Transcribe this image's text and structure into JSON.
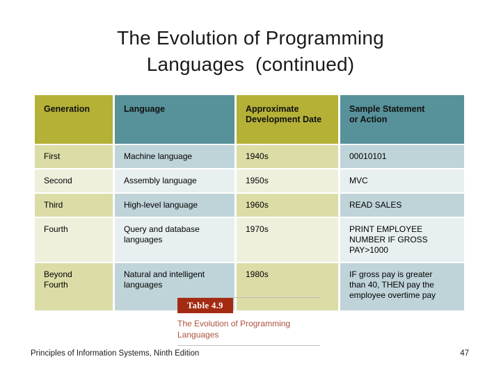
{
  "slide": {
    "title_line1": "The Evolution of Programming",
    "title_line2": "Languages  (continued)"
  },
  "table": {
    "headers": [
      {
        "line1": "Generation",
        "line2": ""
      },
      {
        "line1": "Language",
        "line2": ""
      },
      {
        "line1": "Approximate",
        "line2": "Development Date"
      },
      {
        "line1": "Sample Statement",
        "line2": "or Action"
      }
    ],
    "rows": [
      {
        "generation_l1": "First",
        "generation_l2": "",
        "language_l1": "Machine language",
        "language_l2": "",
        "date": "1940s",
        "sample_l1": "00010101",
        "sample_l2": "",
        "sample_l3": ""
      },
      {
        "generation_l1": "Second",
        "generation_l2": "",
        "language_l1": "Assembly language",
        "language_l2": "",
        "date": "1950s",
        "sample_l1": "MVC",
        "sample_l2": "",
        "sample_l3": ""
      },
      {
        "generation_l1": "Third",
        "generation_l2": "",
        "language_l1": "High-level language",
        "language_l2": "",
        "date": "1960s",
        "sample_l1": "READ SALES",
        "sample_l2": "",
        "sample_l3": ""
      },
      {
        "generation_l1": "Fourth",
        "generation_l2": "",
        "language_l1": "Query and database",
        "language_l2": "languages",
        "date": "1970s",
        "sample_l1": "PRINT EMPLOYEE",
        "sample_l2": "NUMBER IF GROSS",
        "sample_l3": "PAY>1000"
      },
      {
        "generation_l1": "Beyond",
        "generation_l2": "Fourth",
        "language_l1": "Natural and intelligent",
        "language_l2": "languages",
        "date": "1980s",
        "sample_l1": "IF gross pay is greater",
        "sample_l2": "than 40, THEN pay the",
        "sample_l3": "employee overtime pay"
      }
    ]
  },
  "caption": {
    "badge": "Table 4.9",
    "text_line1": "The Evolution of Programming",
    "text_line2": "Languages"
  },
  "footer": {
    "source": "Principles of Information Systems, Ninth Edition",
    "page": "47"
  },
  "colors": {
    "header_olive": "#b5b136",
    "header_teal": "#579199",
    "body_olive_dark": "#dcdca7",
    "body_olive_light": "#eff0dc",
    "body_teal_dark": "#bfd4d9",
    "body_teal_light": "#e8eff0",
    "badge_red": "#a32b12",
    "caption_text": "#ab523c"
  }
}
